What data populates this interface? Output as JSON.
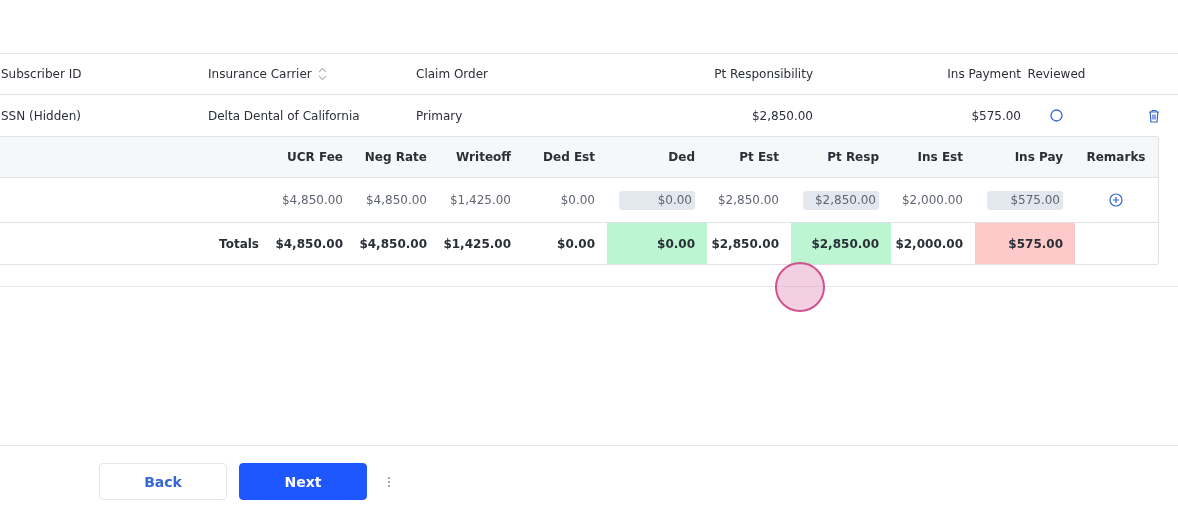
{
  "claims_table": {
    "columns": [
      {
        "label": "Subscriber ID",
        "sortable": false
      },
      {
        "label": "Insurance Carrier",
        "sortable": true
      },
      {
        "label": "Claim Order",
        "sortable": false
      },
      {
        "label": "Pt Responsibility",
        "sortable": false
      },
      {
        "label": "Ins Payment",
        "sortable": false
      },
      {
        "label": "Reviewed",
        "sortable": false
      }
    ],
    "rows": [
      {
        "cells": [
          "SSN (Hidden)",
          "Delta Dental of California",
          "Primary",
          "$2,850.00",
          "$575.00"
        ],
        "reviewed": false,
        "detail": {
          "columns": [
            "UCR Fee",
            "Neg Rate",
            "Writeoff",
            "Ded Est",
            "Ded",
            "Pt Est",
            "Pt Resp",
            "Ins Est",
            "Ins Pay",
            "Remarks"
          ],
          "rows": [
            {
              "kind": "entry",
              "cells": [
                {
                  "kind": "text",
                  "text": "$4,850.00"
                },
                {
                  "kind": "text",
                  "text": "$4,850.00"
                },
                {
                  "kind": "text",
                  "text": "$1,425.00"
                },
                {
                  "kind": "text",
                  "text": "$0.00"
                },
                {
                  "kind": "input",
                  "text": "$0.00"
                },
                {
                  "kind": "text",
                  "text": "$2,850.00"
                },
                {
                  "kind": "input",
                  "text": "$2,850.00"
                },
                {
                  "kind": "text",
                  "text": "$2,000.00"
                },
                {
                  "kind": "input",
                  "text": "$575.00"
                },
                {
                  "kind": "add"
                }
              ]
            },
            {
              "kind": "totals",
              "label": "Totals",
              "cells": [
                {
                  "kind": "text",
                  "text": "$4,850.00"
                },
                {
                  "kind": "text",
                  "text": "$4,850.00"
                },
                {
                  "kind": "text",
                  "text": "$1,425.00"
                },
                {
                  "kind": "text",
                  "text": "$0.00"
                },
                {
                  "kind": "text",
                  "text": "$0.00",
                  "color": "#bbf5d2"
                },
                {
                  "kind": "text",
                  "text": "$2,850.00"
                },
                {
                  "kind": "text",
                  "text": "$2,850.00",
                  "color": "#bbf5d2"
                },
                {
                  "kind": "text",
                  "text": "$2,000.00"
                },
                {
                  "kind": "text",
                  "text": "$575.00",
                  "color": "#fdc9c9"
                },
                {
                  "kind": "empty"
                }
              ]
            }
          ]
        }
      }
    ]
  },
  "footer": {
    "buttons": [
      {
        "label": "Back",
        "kind": "secondary"
      },
      {
        "label": "Next",
        "kind": "primary"
      }
    ]
  }
}
